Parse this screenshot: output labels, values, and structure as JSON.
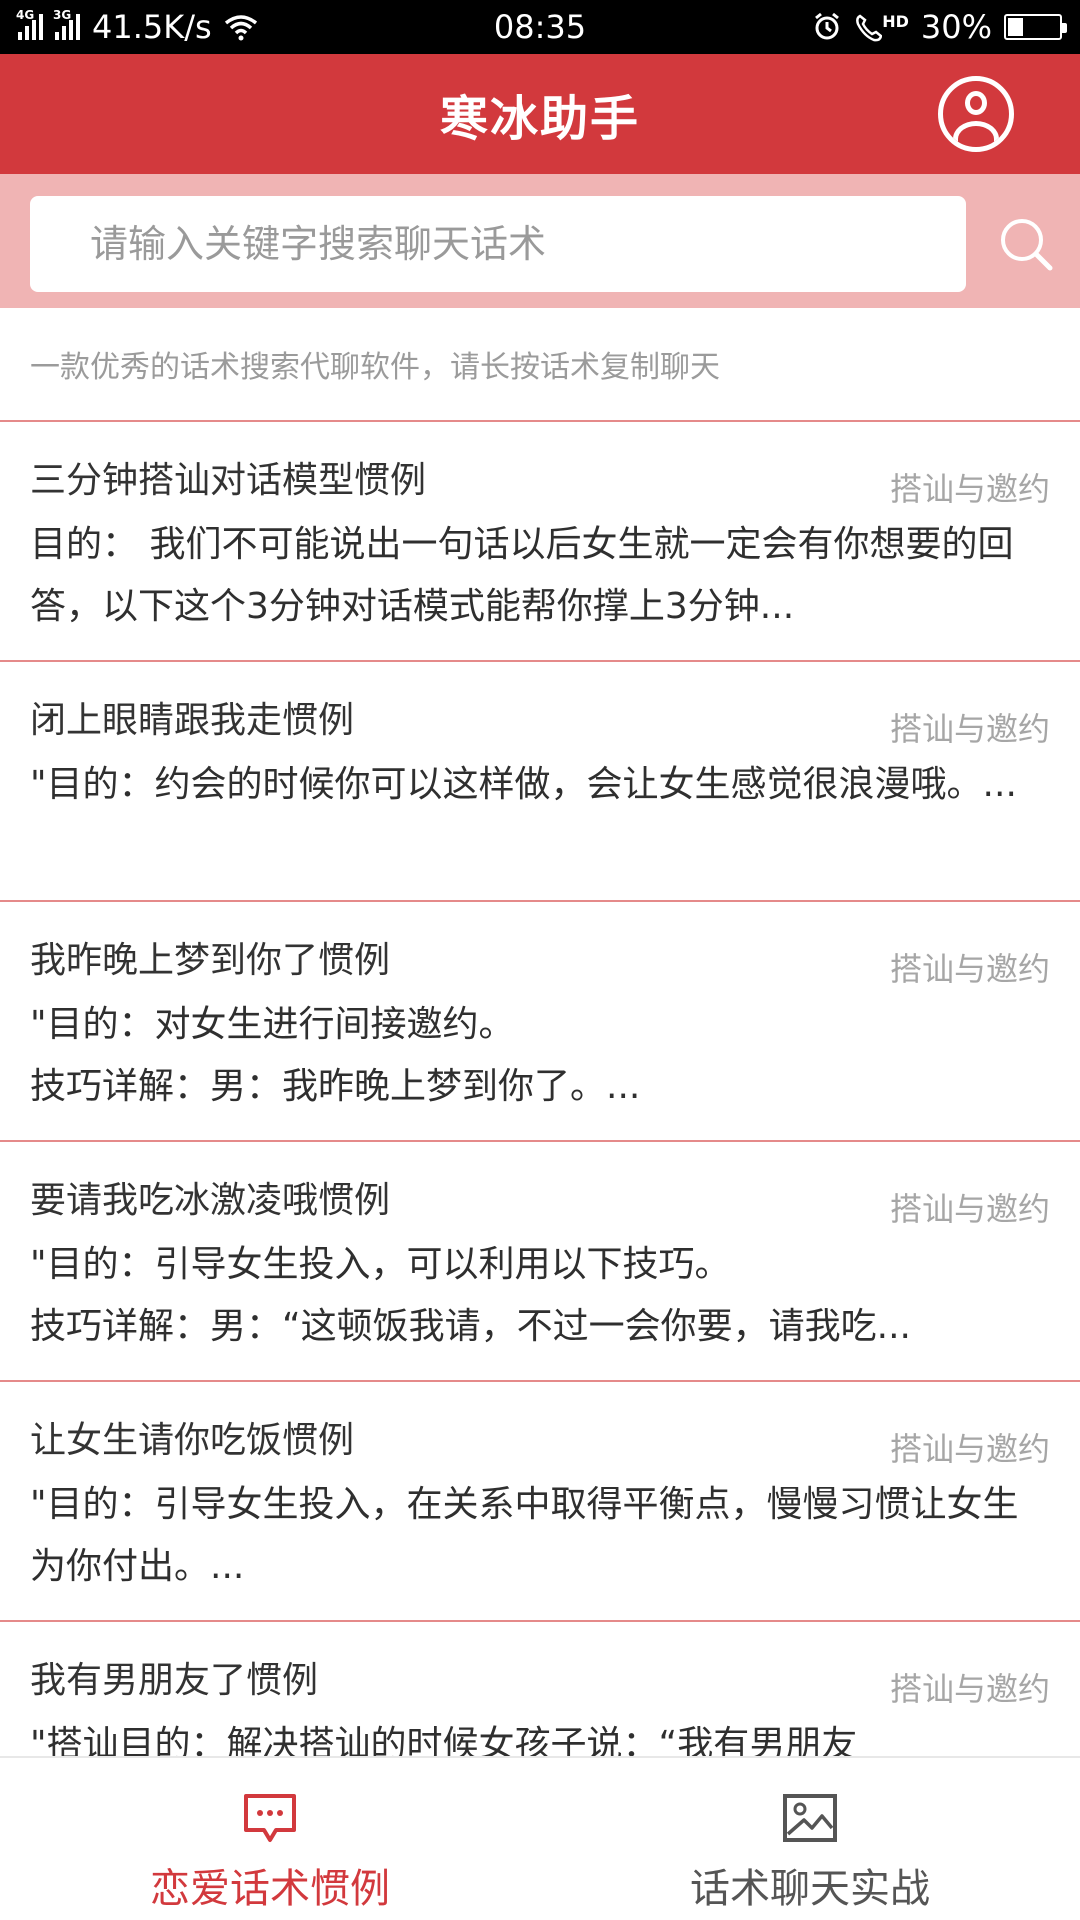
{
  "status_bar": {
    "net_4g": "4G",
    "net_3g": "3G",
    "speed": "41.5K/s",
    "time": "08:35",
    "hd": "HD",
    "battery_percent": "30%",
    "battery_level": 0.3
  },
  "header": {
    "title": "寒冰助手",
    "profile_icon": "user-icon"
  },
  "search": {
    "placeholder": "请输入关键字搜索聊天话术",
    "value": ""
  },
  "subtitle": "一款优秀的话术搜索代聊软件，请长按话术复制聊天",
  "items": [
    {
      "title": "三分钟搭讪对话模型惯例",
      "tag": "搭讪与邀约",
      "desc": "目的： 我们不可能说出一句话以后女生就一定会有你想要的回答，以下这个3分钟对话模式能帮你撑上3分钟..."
    },
    {
      "title": "闭上眼睛跟我走惯例",
      "tag": "搭讪与邀约",
      "desc": "\"目的：约会的时候你可以这样做，会让女生感觉很浪漫哦。..."
    },
    {
      "title": "我昨晚上梦到你了惯例",
      "tag": "搭讪与邀约",
      "desc": "\"目的：对女生进行间接邀约。\n技巧详解：男：我昨晚上梦到你了。..."
    },
    {
      "title": "要请我吃冰激凌哦惯例",
      "tag": "搭讪与邀约",
      "desc": "\"目的：引导女生投入，可以利用以下技巧。\n技巧详解：男：“这顿饭我请，不过一会你要，请我吃..."
    },
    {
      "title": "让女生请你吃饭惯例",
      "tag": "搭讪与邀约",
      "desc": "\"目的：引导女生投入，在关系中取得平衡点，慢慢习惯让女生为你付出。..."
    },
    {
      "title": "我有男朋友了惯例",
      "tag": "搭讪与邀约",
      "desc": "\"搭讪目的：解决搭讪的时候女孩子说：“我有男朋友"
    }
  ],
  "bottom_nav": {
    "tab1_label": "恋爱话术惯例",
    "tab1_icon": "chat-bubble-icon",
    "tab2_label": "话术聊天实战",
    "tab2_icon": "image-icon"
  },
  "colors": {
    "brand_red": "#d2393d",
    "search_bg": "#f0b4b4",
    "divider": "#e58a8a",
    "muted_text": "#9b9b9b"
  }
}
